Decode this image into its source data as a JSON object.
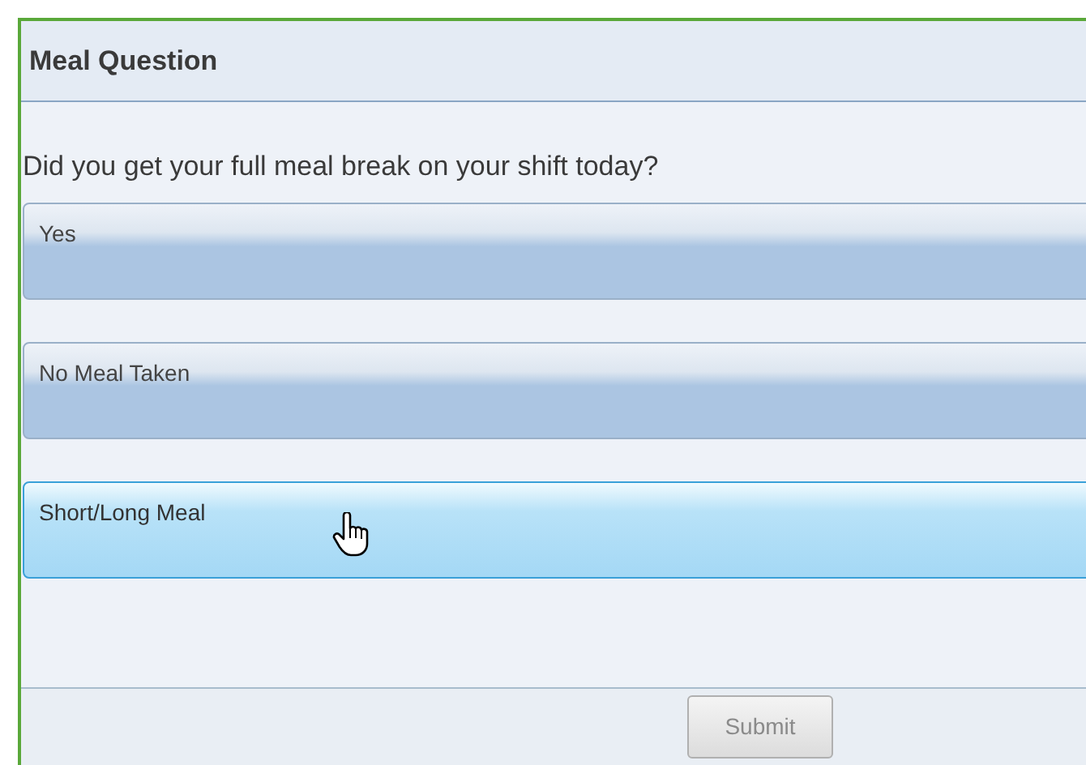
{
  "header": {
    "title": "Meal Question"
  },
  "question": "Did you get your full meal break on your shift today?",
  "options": [
    {
      "label": "Yes",
      "hovered": false
    },
    {
      "label": "No Meal Taken",
      "hovered": false
    },
    {
      "label": "Short/Long Meal",
      "hovered": true
    }
  ],
  "submit": {
    "label": "Submit",
    "disabled": true
  }
}
